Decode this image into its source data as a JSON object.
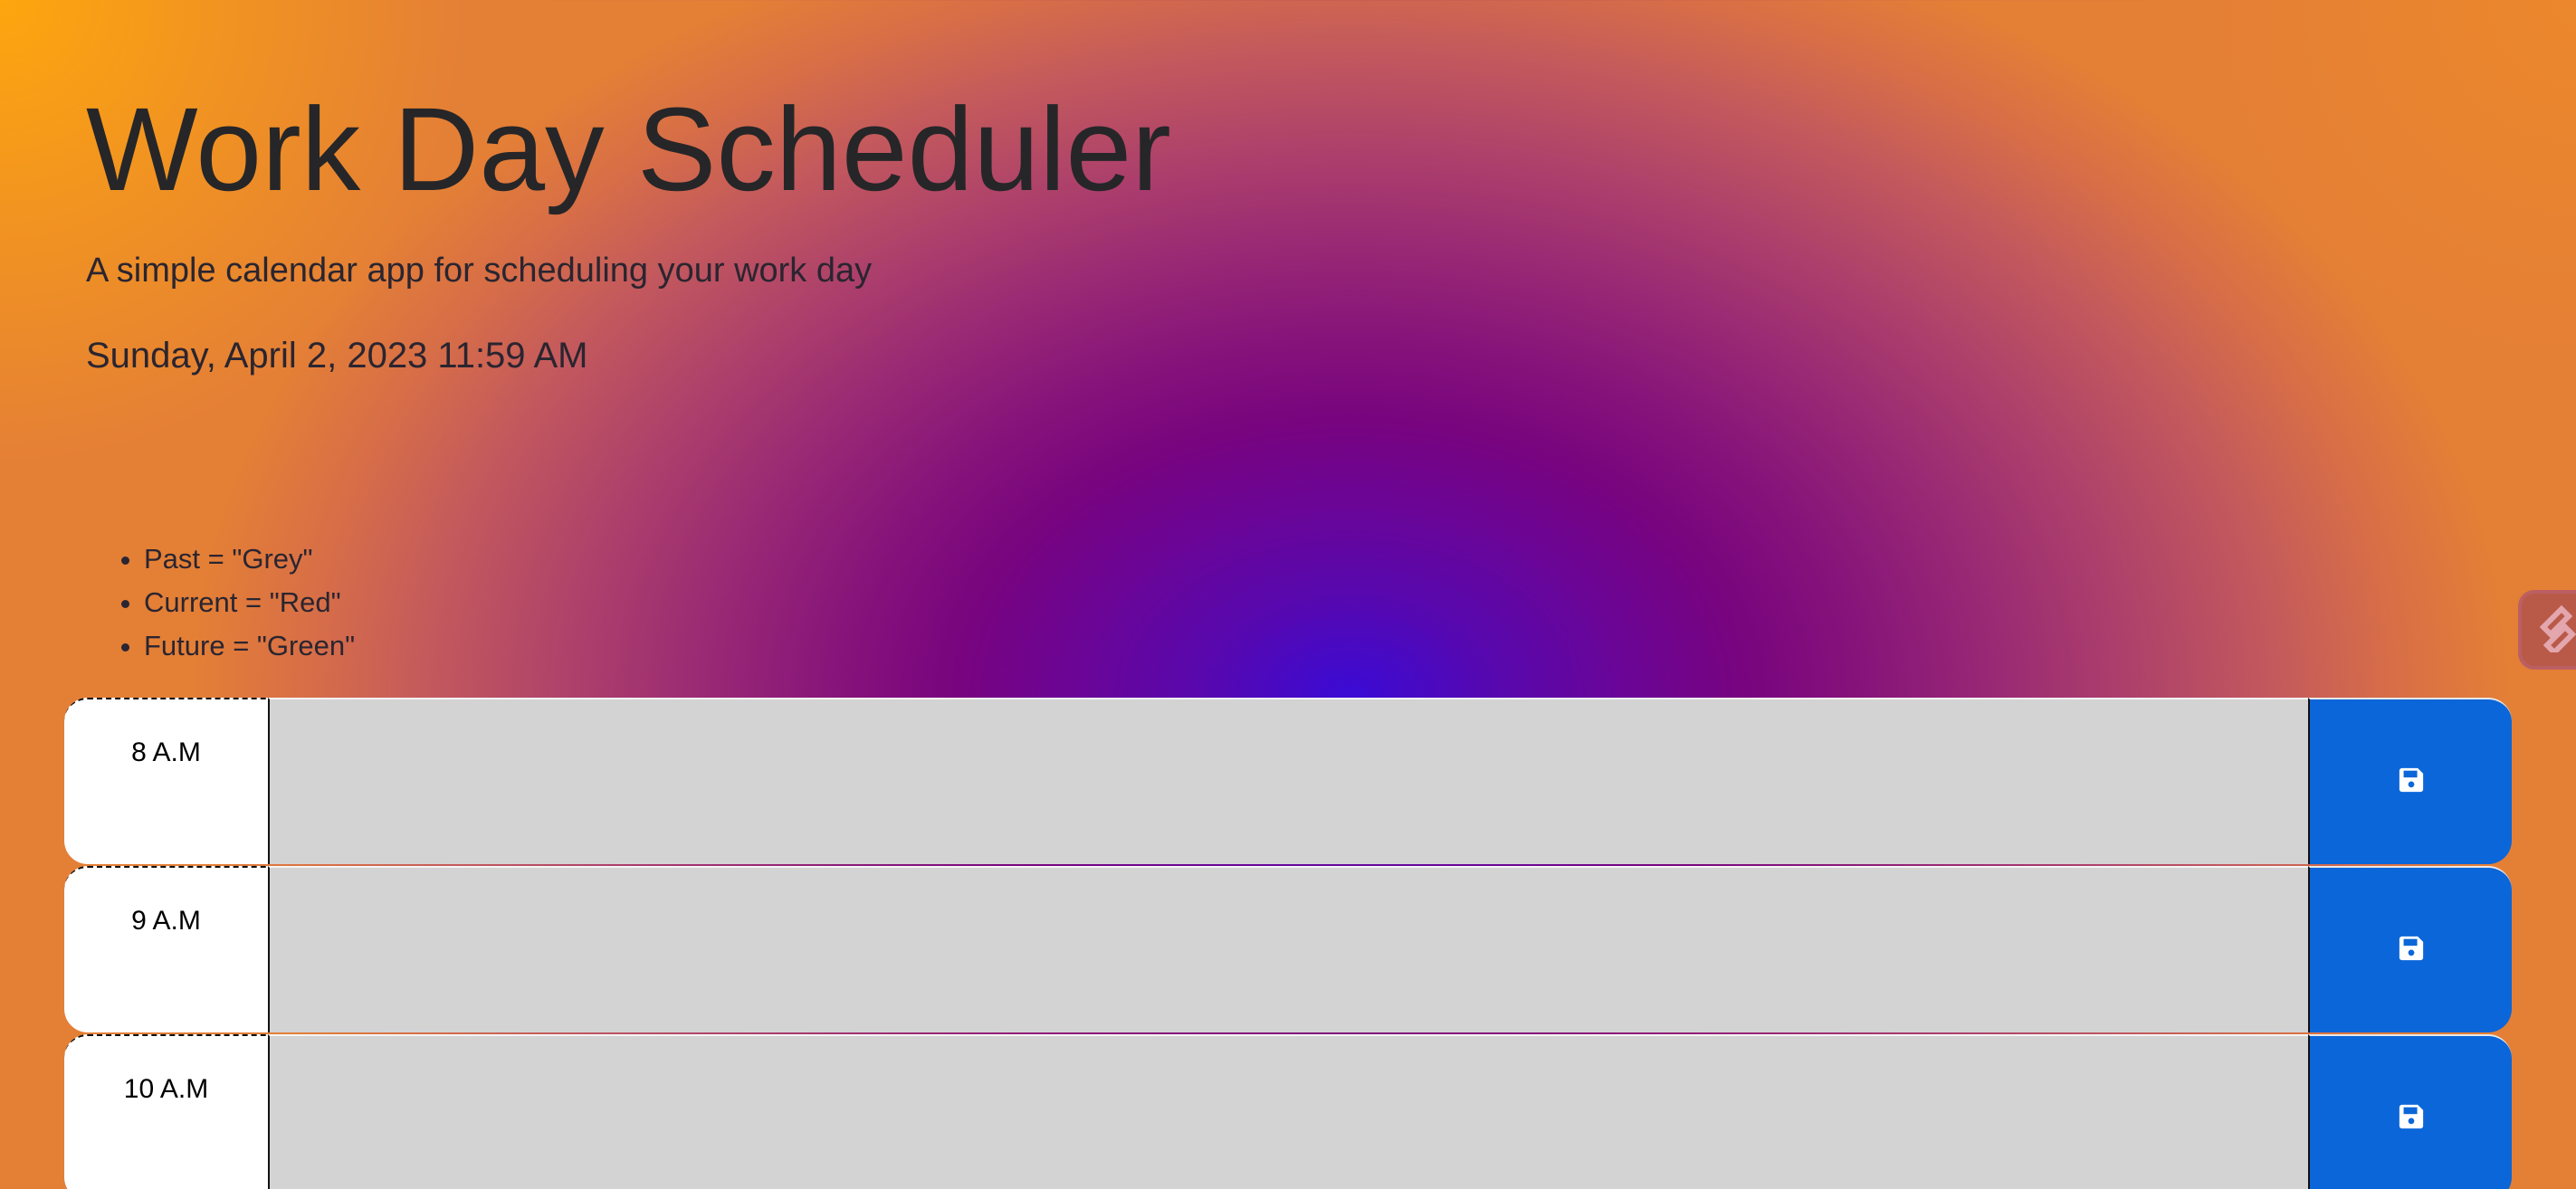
{
  "header": {
    "title": "Work Day Scheduler",
    "lead": "A simple calendar app for scheduling your work day",
    "current_datetime": "Sunday, April 2, 2023 11:59 AM"
  },
  "legend": {
    "items": [
      "Past = \"Grey\"",
      "Current = \"Red\"",
      "Future = \"Green\""
    ]
  },
  "rows": [
    {
      "hour": "8 A.M",
      "task": "",
      "state": "past"
    },
    {
      "hour": "9 A.M",
      "task": "",
      "state": "past"
    },
    {
      "hour": "10 A.M",
      "task": "",
      "state": "past"
    }
  ],
  "colors": {
    "past": "#d3d3d3",
    "save_button": "#0b66d9",
    "hour_bg": "#ffffff"
  },
  "icons": {
    "save": "floppy-disk-icon",
    "side_widget": "extension-pen-icon"
  }
}
